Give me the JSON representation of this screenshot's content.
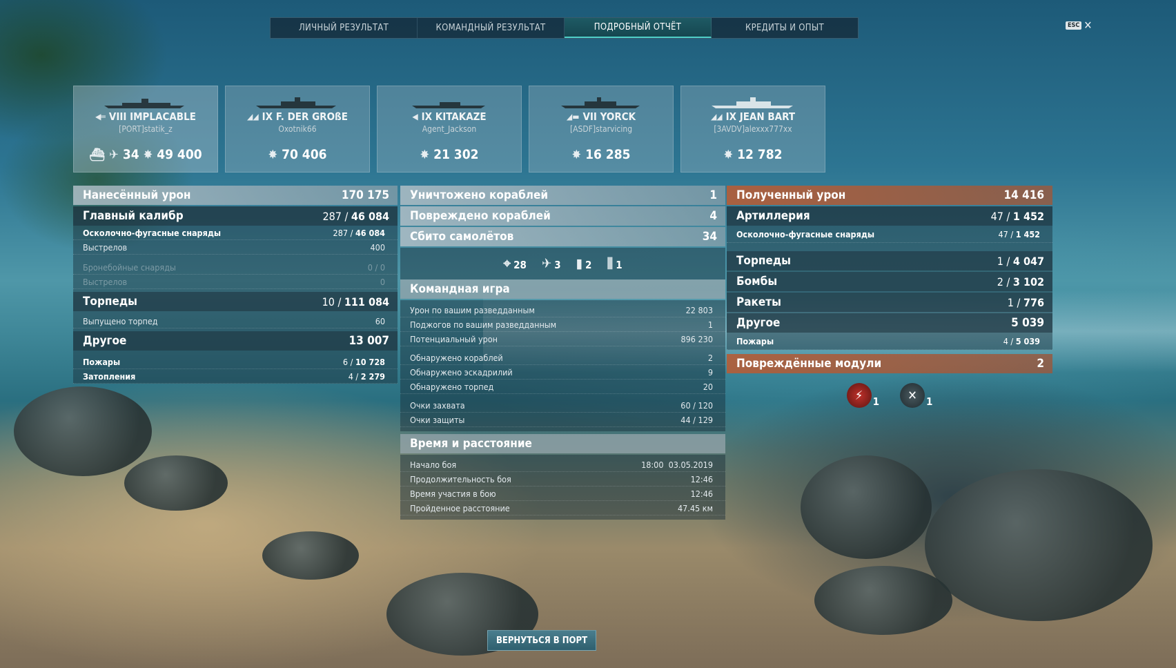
{
  "tabs": [
    {
      "label": "ЛИЧНЫЙ РЕЗУЛЬТАТ"
    },
    {
      "label": "КОМАНДНЫЙ РЕЗУЛЬТАТ"
    },
    {
      "label": "ПОДРОБНЫЙ ОТЧЁТ"
    },
    {
      "label": "КРЕДИТЫ И ОПЫТ"
    }
  ],
  "active_tab": "ПОДРОБНЫЙ ОТЧЁТ",
  "esc": {
    "key": "ESC",
    "close": "✕"
  },
  "ships": [
    {
      "tier_name": "VIII IMPLACABLE",
      "player": "[PORT]statik_z",
      "planes": "34",
      "damage": "49 400"
    },
    {
      "tier_name": "IX F. DER GROßE",
      "player": "Oxotnik66",
      "damage": "70 406"
    },
    {
      "tier_name": "IX KITAKAZE",
      "player": "Agent_Jackson",
      "damage": "21 302"
    },
    {
      "tier_name": "VII YORCK",
      "player": "[ASDF]starvicing",
      "damage": "16 285"
    },
    {
      "tier_name": "IX JEAN BART",
      "player": "[3AVDV]alexxx777xx",
      "damage": "12 782"
    }
  ],
  "dealt": {
    "title": "Нанесённый урон",
    "total": "170 175",
    "main": {
      "label": "Главный калибр",
      "hits": "287",
      "dmg": "46 084"
    },
    "he": {
      "label": "Осколочно-фугасные снаряды",
      "hits": "287",
      "dmg": "46 084"
    },
    "he_shots": {
      "label": "Выстрелов",
      "value": "400"
    },
    "ap": {
      "label": "Бронебойные снаряды",
      "value": "0 / 0"
    },
    "ap_shots": {
      "label": "Выстрелов",
      "value": "0"
    },
    "torps": {
      "label": "Торпеды",
      "hits": "10",
      "dmg": "111 084"
    },
    "torps_fired": {
      "label": "Выпущено торпед",
      "value": "60"
    },
    "other": {
      "label": "Другое",
      "value": "13 007"
    },
    "fires": {
      "label": "Пожары",
      "hits": "6",
      "dmg": "10 728"
    },
    "floods": {
      "label": "Затопления",
      "hits": "4",
      "dmg": "2 279"
    }
  },
  "middle": {
    "destroyed": {
      "label": "Уничтожено кораблей",
      "value": "1"
    },
    "damaged": {
      "label": "Повреждено кораблей",
      "value": "4"
    },
    "planes": {
      "label": "Сбито самолётов",
      "value": "34"
    },
    "air_icons": [
      {
        "icon": "crosshair-icon",
        "value": "28"
      },
      {
        "icon": "fighter-icon",
        "value": "3"
      },
      {
        "icon": "bomb-icon",
        "value": "2"
      },
      {
        "icon": "rocket-icon",
        "value": "1"
      }
    ],
    "team": {
      "title": "Командная игра",
      "rows": [
        {
          "label": "Урон по вашим разведданным",
          "value": "22 803"
        },
        {
          "label": "Поджогов по вашим разведданным",
          "value": "1"
        },
        {
          "label": "Потенциальный урон",
          "value": "896 230"
        },
        {
          "label": "Обнаружено кораблей",
          "value": "2"
        },
        {
          "label": "Обнаружено эскадрилий",
          "value": "9"
        },
        {
          "label": "Обнаружено торпед",
          "value": "20"
        },
        {
          "label": "Очки захвата",
          "value": "60 / 120"
        },
        {
          "label": "Очки защиты",
          "value": "44 / 129"
        }
      ]
    },
    "time": {
      "title": "Время и расстояние",
      "rows": [
        {
          "label": "Начало боя",
          "value": "18:00  03.05.2019"
        },
        {
          "label": "Продолжительность боя",
          "value": "12:46"
        },
        {
          "label": "Время участия в бою",
          "value": "12:46"
        },
        {
          "label": "Пройденное расстояние",
          "value": "47.45 км"
        }
      ]
    }
  },
  "received": {
    "title": "Полученный урон",
    "total": "14 416",
    "art": {
      "label": "Артиллерия",
      "hits": "47",
      "dmg": "1 452"
    },
    "he": {
      "label": "Осколочно-фугасные снаряды",
      "hits": "47",
      "dmg": "1 452"
    },
    "torps": {
      "label": "Торпеды",
      "hits": "1",
      "dmg": "4 047"
    },
    "bombs": {
      "label": "Бомбы",
      "hits": "2",
      "dmg": "3 102"
    },
    "rockets": {
      "label": "Ракеты",
      "hits": "1",
      "dmg": "776"
    },
    "other": {
      "label": "Другое",
      "value": "5 039"
    },
    "fires": {
      "label": "Пожары",
      "hits": "4",
      "dmg": "5 039"
    },
    "modules": {
      "label": "Повреждённые модули",
      "value": "2"
    },
    "module_icons": [
      {
        "icon": "fire-module-icon",
        "value": "1"
      },
      {
        "icon": "broken-module-icon",
        "value": "1"
      }
    ]
  },
  "back_button": "ВЕРНУТЬСЯ В ПОРТ"
}
